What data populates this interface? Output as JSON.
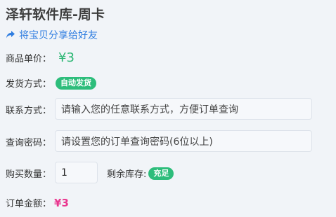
{
  "title": "泽轩软件库-周卡",
  "share": {
    "icon": "share-icon",
    "label": "将宝贝分享给好友"
  },
  "price": {
    "label": "商品单价：",
    "value": "¥3"
  },
  "delivery": {
    "label": "发货方式：",
    "badge": "自动发货"
  },
  "contact": {
    "label": "联系方式：",
    "placeholder": "请输入您的任意联系方式，方便订单查询"
  },
  "query_password": {
    "label": "查询密码：",
    "placeholder": "请设置您的订单查询密码(6位以上)"
  },
  "quantity": {
    "label": "购买数量：",
    "value": "1",
    "stock_label": "剩余库存:",
    "stock_badge": "充足"
  },
  "total": {
    "label": "订单金额：",
    "value": "¥3"
  },
  "colors": {
    "accent_green": "#2dbd7b",
    "link_blue": "#2f7de0",
    "total_pink": "#e9378f"
  }
}
